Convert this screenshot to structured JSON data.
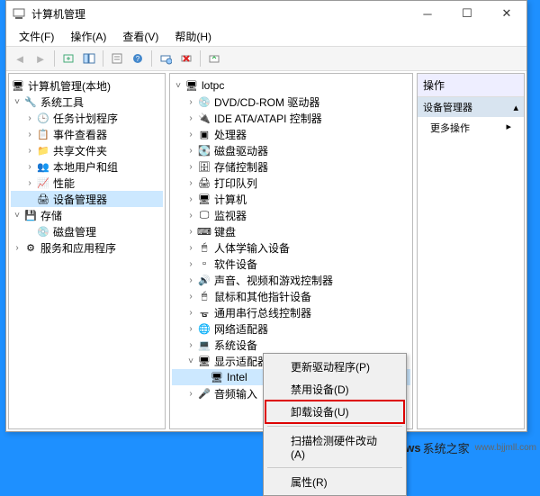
{
  "window": {
    "title": "计算机管理"
  },
  "menubar": {
    "file": "文件(F)",
    "action": "操作(A)",
    "view": "查看(V)",
    "help": "帮助(H)"
  },
  "left_tree": {
    "root": "计算机管理(本地)",
    "system_tools": "系统工具",
    "task_scheduler": "任务计划程序",
    "event_viewer": "事件查看器",
    "shared_folders": "共享文件夹",
    "local_users": "本地用户和组",
    "performance": "性能",
    "device_manager": "设备管理器",
    "storage": "存储",
    "disk_mgmt": "磁盘管理",
    "services_apps": "服务和应用程序"
  },
  "mid_tree": {
    "root": "lotpc",
    "dvd": "DVD/CD-ROM 驱动器",
    "ide": "IDE ATA/ATAPI 控制器",
    "cpu": "处理器",
    "disk_drives": "磁盘驱动器",
    "storage_ctrl": "存储控制器",
    "print_queues": "打印队列",
    "computer": "计算机",
    "monitors": "监视器",
    "keyboards": "键盘",
    "hid": "人体学输入设备",
    "software": "软件设备",
    "sound": "声音、视频和游戏控制器",
    "mice": "鼠标和其他指针设备",
    "usb": "通用串行总线控制器",
    "network": "网络适配器",
    "system": "系统设备",
    "display": "显示适配器",
    "intel": "Intel",
    "audio_in": "音频输入"
  },
  "right_pane": {
    "header": "操作",
    "section": "设备管理器",
    "more": "更多操作"
  },
  "context_menu": {
    "update": "更新驱动程序(P)",
    "disable": "禁用设备(D)",
    "uninstall": "卸载设备(U)",
    "scan": "扫描检测硬件改动(A)",
    "properties": "属性(R)"
  },
  "watermark": {
    "brand": "Windows",
    "site": "系统之家",
    "url": "www.bjjmll.com"
  }
}
